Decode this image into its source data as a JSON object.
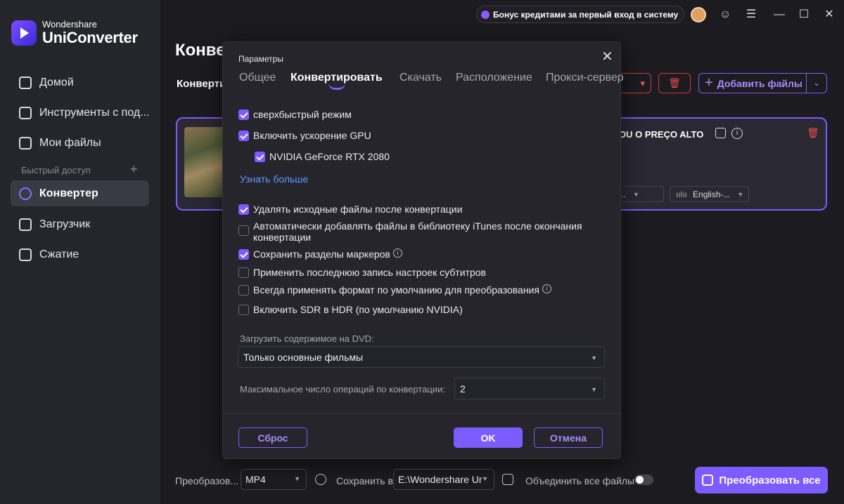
{
  "app": {
    "brand_small": "Wondershare",
    "brand_big": "UniConverter"
  },
  "sidebar": {
    "items": [
      {
        "label": "Домой",
        "icon": "home-icon"
      },
      {
        "label": "Инструменты с под...",
        "icon": "toolbox-icon"
      },
      {
        "label": "Мои файлы",
        "icon": "files-icon"
      }
    ],
    "quick_access_label": "Быстрый доступ",
    "quick_items": [
      {
        "label": "Конвертер",
        "icon": "converter-icon",
        "active": true
      },
      {
        "label": "Загрузчик",
        "icon": "downloader-icon"
      },
      {
        "label": "Сжатие",
        "icon": "compress-icon"
      }
    ]
  },
  "topbar": {
    "bonus_text": "Бонус кредитами за первый вход в систему"
  },
  "main": {
    "title": "Конвертер",
    "sub_tab": "Конвертирование",
    "add_files_label": "Добавить файлы",
    "file": {
      "title": "OU O PREÇO ALTO",
      "subtitle_select": "суб...",
      "audio_select": "English-..."
    }
  },
  "bottom": {
    "convert_label": "Преобразов...",
    "format": "MP4",
    "save_to_label": "Сохранить в",
    "save_path": "E:\\Wondershare Ur",
    "merge_label": "Объединить все файлы",
    "convert_all_label": "Преобразовать все"
  },
  "modal": {
    "title": "Параметры",
    "tabs": [
      "Общее",
      "Конвертировать",
      "Скачать",
      "Расположение",
      "Прокси-сервер"
    ],
    "active_tab": "Конвертировать",
    "options": {
      "superfast": {
        "label": "сверхбыстрый режим",
        "checked": true
      },
      "gpu": {
        "label": "Включить ускорение GPU",
        "checked": true
      },
      "nvidia": {
        "label": "NVIDIA GeForce RTX 2080",
        "checked": true
      },
      "learn_more": "Узнать больше",
      "delete_source": {
        "label": "Удалять исходные файлы после конвертации",
        "checked": true
      },
      "itunes": {
        "label": "Автоматически добавлять файлы в библиотеку iTunes после окончания конвертации",
        "checked": false
      },
      "markers": {
        "label": "Сохранить разделы маркеров",
        "checked": true
      },
      "subtitles": {
        "label": "Применить последнюю запись настроек субтитров",
        "checked": false
      },
      "default_format": {
        "label": "Всегда применять формат по умолчанию для преобразования",
        "checked": false
      },
      "sdr_hdr": {
        "label": "Включить SDR в HDR (по умолчанию NVIDIA)",
        "checked": false
      }
    },
    "dvd_label": "Загрузить содержимое на DVD:",
    "dvd_value": "Только основные фильмы",
    "max_ops_label": "Максимальное число операций по конвертации:",
    "max_ops_value": "2",
    "reset_label": "Сброс",
    "ok_label": "OK",
    "cancel_label": "Отмена"
  },
  "colors": {
    "accent": "#7c5cff",
    "danger": "#d23a3a",
    "link": "#5d9bff"
  }
}
